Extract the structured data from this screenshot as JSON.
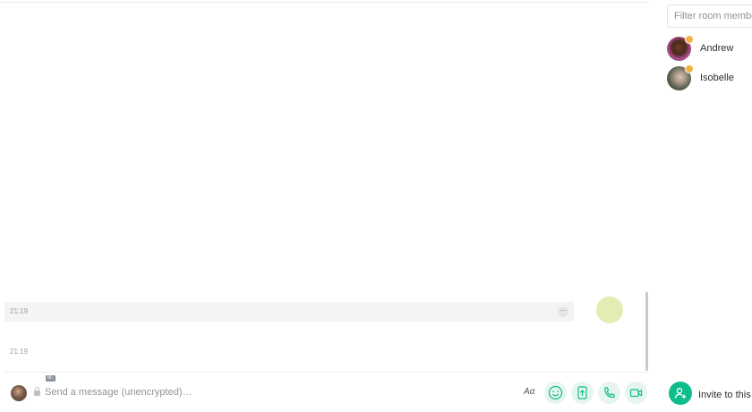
{
  "timeline": {
    "events": [
      {
        "timestamp": "21:19",
        "options_glyph": "···"
      },
      {
        "timestamp": "21:19"
      }
    ]
  },
  "composer": {
    "markdown_badge": "M↓",
    "placeholder": "Send a message (unencrypted)…",
    "format_toggle": "Aα"
  },
  "members_panel": {
    "filter_placeholder": "Filter room members",
    "members": [
      {
        "name": "Andrew"
      },
      {
        "name": "Isobelle"
      }
    ],
    "invite_label": "Invite to this room"
  },
  "colors": {
    "accent": "#0dbd8b",
    "composer_button_bg": "#e7f5ef",
    "highlight_row": "#f4f4f4",
    "read_receipt": "#e3edb3"
  },
  "icons": [
    "options-icon",
    "lock-icon",
    "markdown-icon",
    "emoji-icon",
    "upload-icon",
    "voice-call-icon",
    "video-call-icon",
    "invite-icon",
    "power-level-icon"
  ]
}
